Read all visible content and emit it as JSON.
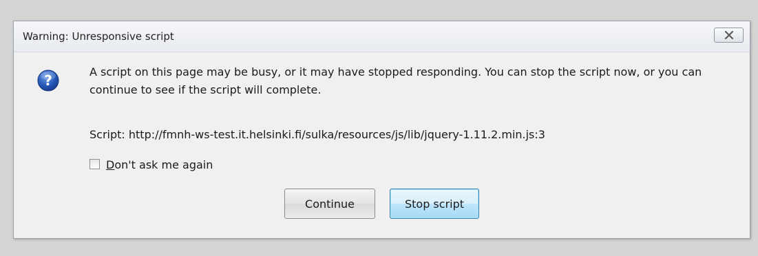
{
  "dialog": {
    "title": "Warning: Unresponsive script",
    "icon": "question-icon",
    "message": "A script on this page may be busy, or it may have stopped responding. You can stop the script now, or you can continue to see if the script will complete.",
    "script_label": "Script:",
    "script_url": "http://fmnh-ws-test.it.helsinki.fi/sulka/resources/js/lib/jquery-1.11.2.min.js:3",
    "checkbox": {
      "accesskey": "D",
      "label_rest": "on't ask me again",
      "checked": false
    },
    "buttons": {
      "continue_label": "Continue",
      "stop_label": "Stop script"
    }
  },
  "colors": {
    "background": "#d4d4d4",
    "dialog_bg": "#f0f0f0",
    "focus_border": "#3c7fb1",
    "icon_blue": "#1f4fa8"
  }
}
